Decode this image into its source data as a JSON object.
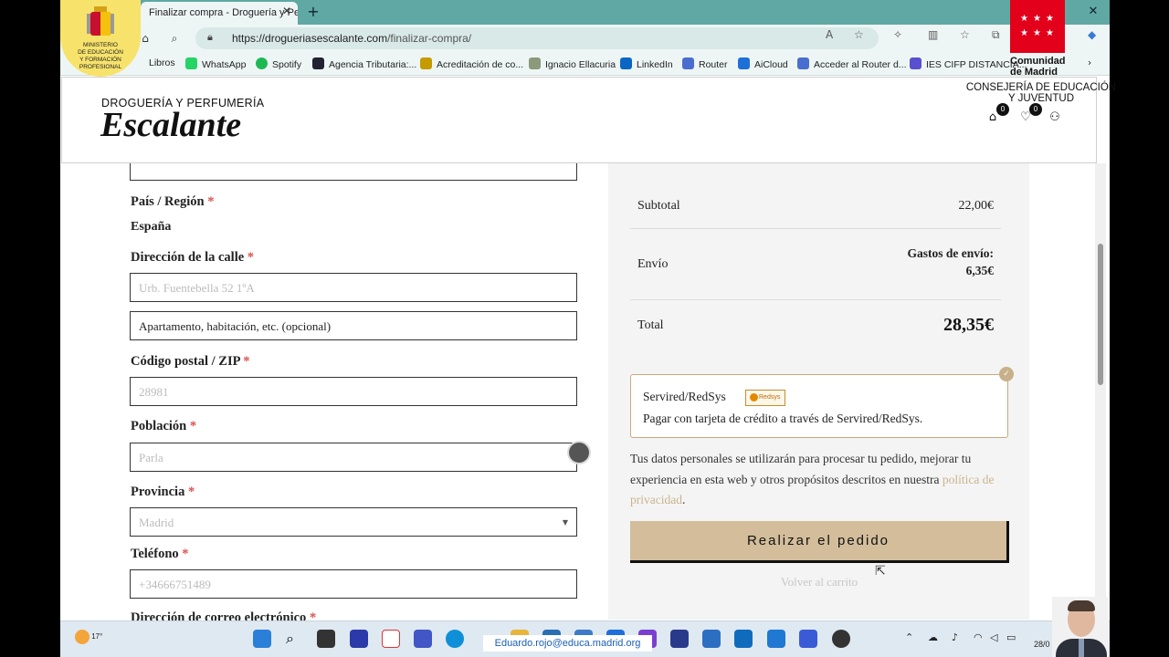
{
  "browser": {
    "tab_title": "Finalizar compra - Droguería y Pe",
    "url_domain": "https://drogueriasescalante.com",
    "url_path": "/finalizar-compra/",
    "bookmarks": [
      "Libros",
      "WhatsApp",
      "Spotify",
      "Agencia Tributaria:...",
      "Acreditación de co...",
      "Ignacio Ellacuria",
      "LinkedIn",
      "Router",
      "AiCloud",
      "Acceder al Router d...",
      "IES CIFP DISTANCIA..."
    ]
  },
  "overlays": {
    "ministerio_line1": "MINISTERIO",
    "ministerio_line2": "DE EDUCACIÓN",
    "ministerio_line3": "Y FORMACIÓN",
    "ministerio_line4": "PROFESIONAL",
    "madrid_line1": "Comunidad",
    "madrid_line2": "de Madrid",
    "consejeria_line1": "CONSEJERÍA DE EDUCACIÓN",
    "consejeria_line2": "Y JUVENTUD"
  },
  "header": {
    "brand_top": "DROGUERÍA Y PERFUMERÍA",
    "brand_name": "Escalante",
    "cart_count": "0",
    "wishlist_count": "0"
  },
  "form": {
    "country_label": "País / Región",
    "country_value": "España",
    "street_label": "Dirección de la calle",
    "street_value": "Urb. Fuentebella 52 1ºA",
    "apartment_placeholder": "Apartamento, habitación, etc. (opcional)",
    "postcode_label": "Código postal / ZIP",
    "postcode_value": "28981",
    "city_label": "Población",
    "city_value": "Parla",
    "province_label": "Provincia",
    "province_value": "Madrid",
    "phone_label": "Teléfono",
    "phone_value": "+34666751489",
    "email_label_partial": "Dirección de correo electrónico",
    "required_mark": "*"
  },
  "summary": {
    "subtotal_label": "Subtotal",
    "subtotal_value": "22,00€",
    "shipping_label": "Envío",
    "shipping_value_line1": "Gastos de envío:",
    "shipping_value_line2": "6,35€",
    "total_label": "Total",
    "total_value": "28,35€",
    "payment_name": "Servired/RedSys",
    "payment_logo_text": "Redsys",
    "payment_desc": "Pagar con tarjeta de crédito a través de Servired/RedSys.",
    "privacy_text": "Tus datos personales se utilizarán para procesar tu pedido, mejorar tu experiencia en esta web y otros propósitos descritos en nuestra ",
    "privacy_link": "política de privacidad",
    "privacy_end": ".",
    "place_order": "Realizar el pedido",
    "back_to_cart": "Volver al carrito"
  },
  "taskbar": {
    "temperature": "17°",
    "email": "Eduardo.rojo@educa.madrid.org",
    "clock": "28/0"
  },
  "colors": {
    "accent": "#d3bd9b",
    "required": "#d9534f",
    "link": "#c9b48d",
    "tabbar": "#5fa8a3",
    "madrid_red": "#e2001a"
  }
}
